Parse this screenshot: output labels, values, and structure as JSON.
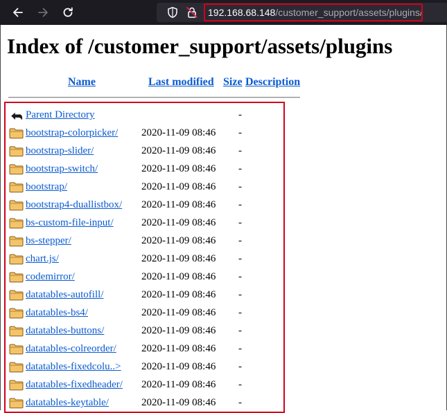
{
  "browser": {
    "url_host": "192.168.68.148",
    "url_path": "/customer_support/assets/plugins/",
    "icons": [
      "back-icon",
      "forward-icon",
      "reload-icon",
      "shield-icon",
      "lock-icon"
    ]
  },
  "page": {
    "title": "Index of /customer_support/assets/plugins"
  },
  "table": {
    "headers": {
      "name": "Name",
      "last_modified": "Last modified",
      "size": "Size",
      "description": "Description"
    },
    "rows": [
      {
        "name": "Parent Directory",
        "date": "",
        "size": "-",
        "icon": "back-icon"
      },
      {
        "name": "bootstrap-colorpicker/",
        "date": "2020-11-09 08:46",
        "size": "-",
        "icon": "folder-icon"
      },
      {
        "name": "bootstrap-slider/",
        "date": "2020-11-09 08:46",
        "size": "-",
        "icon": "folder-icon"
      },
      {
        "name": "bootstrap-switch/",
        "date": "2020-11-09 08:46",
        "size": "-",
        "icon": "folder-icon"
      },
      {
        "name": "bootstrap/",
        "date": "2020-11-09 08:46",
        "size": "-",
        "icon": "folder-icon"
      },
      {
        "name": "bootstrap4-duallistbox/",
        "date": "2020-11-09 08:46",
        "size": "-",
        "icon": "folder-icon"
      },
      {
        "name": "bs-custom-file-input/",
        "date": "2020-11-09 08:46",
        "size": "-",
        "icon": "folder-icon"
      },
      {
        "name": "bs-stepper/",
        "date": "2020-11-09 08:46",
        "size": "-",
        "icon": "folder-icon"
      },
      {
        "name": "chart.js/",
        "date": "2020-11-09 08:46",
        "size": "-",
        "icon": "folder-icon"
      },
      {
        "name": "codemirror/",
        "date": "2020-11-09 08:46",
        "size": "-",
        "icon": "folder-icon"
      },
      {
        "name": "datatables-autofill/",
        "date": "2020-11-09 08:46",
        "size": "-",
        "icon": "folder-icon"
      },
      {
        "name": "datatables-bs4/",
        "date": "2020-11-09 08:46",
        "size": "-",
        "icon": "folder-icon"
      },
      {
        "name": "datatables-buttons/",
        "date": "2020-11-09 08:46",
        "size": "-",
        "icon": "folder-icon"
      },
      {
        "name": "datatables-colreorder/",
        "date": "2020-11-09 08:46",
        "size": "-",
        "icon": "folder-icon"
      },
      {
        "name": "datatables-fixedcolu..>",
        "date": "2020-11-09 08:46",
        "size": "-",
        "icon": "folder-icon"
      },
      {
        "name": "datatables-fixedheader/",
        "date": "2020-11-09 08:46",
        "size": "-",
        "icon": "folder-icon"
      },
      {
        "name": "datatables-keytable/",
        "date": "2020-11-09 08:46",
        "size": "-",
        "icon": "folder-icon"
      }
    ]
  },
  "colors": {
    "toolbar_bg": "#1c1b22",
    "link": "#0a5bd1",
    "highlight": "#d0021b"
  }
}
